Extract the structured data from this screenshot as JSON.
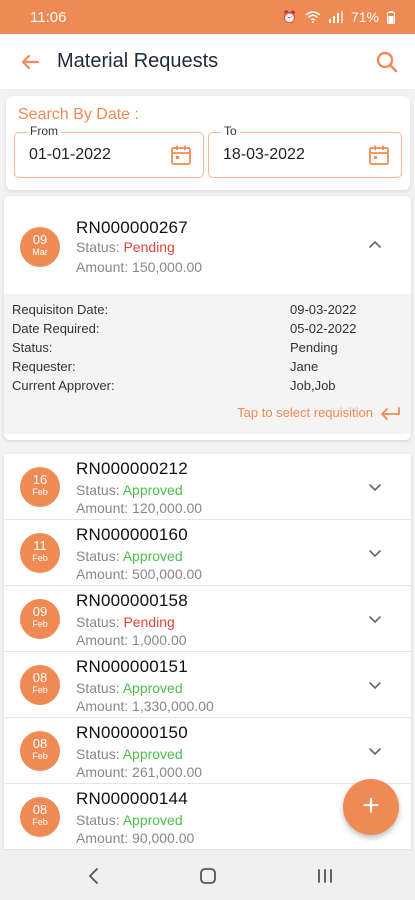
{
  "status_bar": {
    "time": "11:06",
    "battery": "71%",
    "icons": [
      "alarm-icon",
      "wifi-icon",
      "signal-icon",
      "battery-icon"
    ]
  },
  "header": {
    "title": "Material Requests",
    "back_icon": "arrow-left-icon",
    "search_icon": "search-icon"
  },
  "search": {
    "label": "Search By Date :",
    "from_label": "From",
    "from_value": "01-01-2022",
    "to_label": "To",
    "to_value": "18-03-2022"
  },
  "expanded": {
    "day": "09",
    "month": "Mar",
    "rn": "RN000000267",
    "status_prefix": "Status: ",
    "status": "Pending",
    "amount_text": "Amount: 150,000.00",
    "details": [
      {
        "key": "Requisiton Date:",
        "value": "09-03-2022"
      },
      {
        "key": "Date Required:",
        "value": "05-02-2022"
      },
      {
        "key": "Status:",
        "value": "Pending"
      },
      {
        "key": "Requester:",
        "value": "Jane"
      },
      {
        "key": "Current Approver:",
        "value": "Job,Job"
      }
    ],
    "tap_text": "Tap to select requisition"
  },
  "requests": [
    {
      "day": "16",
      "month": "Feb",
      "rn": "RN000000212",
      "status_prefix": "Status: ",
      "status": "Approved",
      "amount_text": "Amount: 120,000.00"
    },
    {
      "day": "11",
      "month": "Feb",
      "rn": "RN000000160",
      "status_prefix": "Status: ",
      "status": "Approved",
      "amount_text": "Amount: 500,000.00"
    },
    {
      "day": "09",
      "month": "Feb",
      "rn": "RN000000158",
      "status_prefix": "Status: ",
      "status": "Pending",
      "amount_text": "Amount: 1,000.00"
    },
    {
      "day": "08",
      "month": "Feb",
      "rn": "RN000000151",
      "status_prefix": "Status: ",
      "status": "Approved",
      "amount_text": "Amount: 1,330,000.00"
    },
    {
      "day": "08",
      "month": "Feb",
      "rn": "RN000000150",
      "status_prefix": "Status: ",
      "status": "Approved",
      "amount_text": "Amount: 261,000.00"
    },
    {
      "day": "08",
      "month": "Feb",
      "rn": "RN000000144",
      "status_prefix": "Status: ",
      "status": "Approved",
      "amount_text": "Amount: 90,000.00"
    }
  ],
  "colors": {
    "accent": "#f08a54",
    "pending": "#e0453a",
    "approved": "#4cbf4c"
  },
  "fab": {
    "label": "+"
  }
}
